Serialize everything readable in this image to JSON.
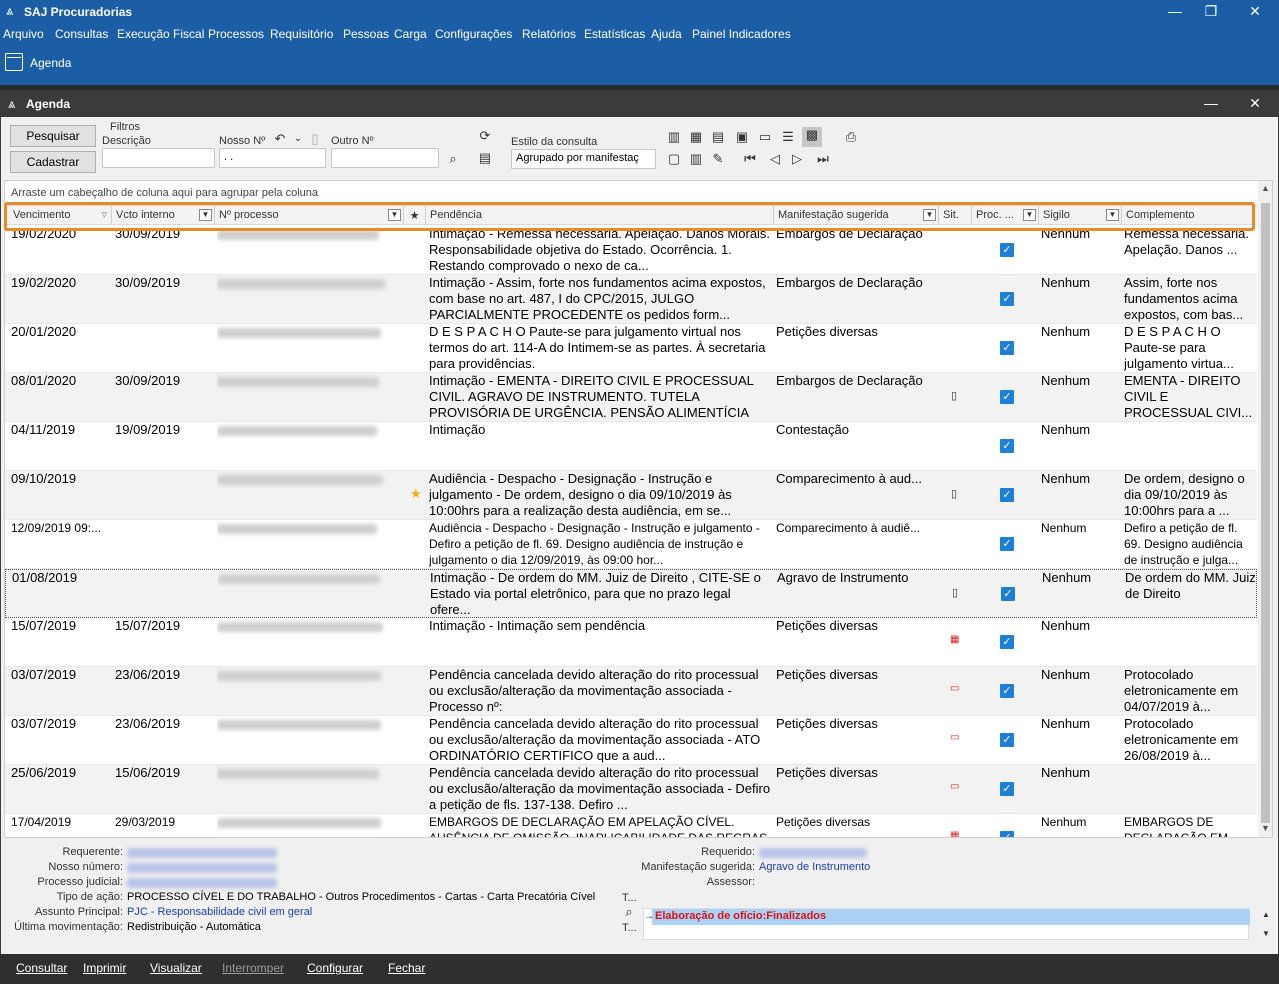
{
  "app": {
    "title": "SAJ Procuradorias"
  },
  "menu": [
    "Arquivo",
    "Consultas",
    "Execução Fiscal",
    "Processos",
    "Requisitório",
    "Pessoas",
    "Carga",
    "Configurações",
    "Relatórios",
    "Estatísticas",
    "Ajuda",
    "Painel Indicadores"
  ],
  "toolbar": {
    "agenda_label": "Agenda"
  },
  "window": {
    "title": "Agenda"
  },
  "filters": {
    "group_label": "Filtros",
    "pesquisar": "Pesquisar",
    "cadastrar": "Cadastrar",
    "descricao_label": "Descrição",
    "nosso_label": "Nosso Nº",
    "nosso_value": ". .",
    "outro_label": "Outro Nº",
    "estilo_label": "Estilo da consulta",
    "estilo_value": "Agrupado por manifestaç"
  },
  "grid": {
    "group_hint": "Arraste um cabeçalho de coluna aqui para agrupar pela coluna",
    "columns": [
      "Vencimento",
      "Vcto interno",
      "Nº processo",
      "★",
      "Pendência",
      "Manifestação sugerida",
      "Sit.",
      "Proc. ...",
      "Sigilo",
      "Complemento"
    ],
    "rows": [
      {
        "venc": "19/02/2020",
        "vcto": "30/09/2019",
        "pend": "Intimação - Remessa necessária. Apelação. Danos Morais. Responsabilidade objetiva do Estado. Ocorrência. 1. Restando comprovado o nexo de ca...",
        "manif": "Embargos de Declaração",
        "sit": "",
        "sigilo": "Nenhum",
        "comp": "Remessa necessária. Apelação. Danos ..."
      },
      {
        "venc": "19/02/2020",
        "vcto": "30/09/2019",
        "pend": "Intimação - Assim, forte nos fundamentos acima expostos, com base no art. 487, I do CPC/2015, JULGO PARCIALMENTE PROCEDENTE os pedidos form...",
        "manif": "Embargos de Declaração",
        "sit": "",
        "sigilo": "Nenhum",
        "comp": "Assim, forte nos fundamentos acima expostos, com bas..."
      },
      {
        "venc": "20/01/2020",
        "vcto": "",
        "pend": "D E S P A C H O Paute-se para julgamento virtual nos termos do art. 114-A do           Intimem-se as partes. À secretaria para providências.",
        "manif": "Petições diversas",
        "sit": "",
        "sigilo": "Nenhum",
        "comp": "D E S P A C H O Paute-se para julgamento virtua..."
      },
      {
        "venc": "08/01/2020",
        "vcto": "30/09/2019",
        "pend": "Intimação - EMENTA - DIREITO CIVIL E PROCESSUAL CIVIL. AGRAVO DE INSTRUMENTO. TUTELA PROVISÓRIA DE URGÊNCIA. PENSÃO ALIMENTÍCIA M...",
        "manif": "Embargos de Declaração",
        "sit": "doc",
        "sigilo": "Nenhum",
        "comp": "EMENTA - DIREITO CIVIL E PROCESSUAL CIVI..."
      },
      {
        "venc": "04/11/2019",
        "vcto": "19/09/2019",
        "pend": "Intimação",
        "manif": "Contestação",
        "sit": "",
        "sigilo": "Nenhum",
        "comp": ""
      },
      {
        "venc": "09/10/2019",
        "vcto": "",
        "pend": "Audiência - Despacho - Designação - Instrução e julgamento - De ordem, designo o dia 09/10/2019 às 10:00hrs para a realização desta audiência, em se...",
        "manif": "Comparecimento à aud...",
        "sit": "doc",
        "star": true,
        "sigilo": "Nenhum",
        "comp": "De ordem, designo o dia 09/10/2019 às 10:00hrs para a ..."
      },
      {
        "venc": "12/09/2019 09:...",
        "vcto": "",
        "pend": "Audiência - Despacho - Designação - Instrução e julgamento - Defiro a petição de fl. 69. Designo audiência de instrução e julgamento o dia 12/09/2019, às 09:00 hor...",
        "manif": "Comparecimento à audiê...",
        "sit": "",
        "sigilo": "Nenhum",
        "comp": "Defiro a petição de fl. 69. Designo audiência de instrução e julga...",
        "light": true
      },
      {
        "venc": "01/08/2019",
        "vcto": "",
        "pend": "Intimação - De ordem do MM. Juiz de Direito                                 , CITE-SE o Estado                       via portal eletrônico, para que no prazo legal ofere...",
        "manif": "Agravo de Instrumento",
        "sit": "doc",
        "sigilo": "Nenhum",
        "comp": "De ordem do MM. Juiz de Direito",
        "sel": true
      },
      {
        "venc": "15/07/2019",
        "vcto": "15/07/2019",
        "pend": "Intimação - Intimação sem pendência",
        "manif": "Petições diversas",
        "sit": "cal",
        "sigilo": "Nenhum",
        "comp": ""
      },
      {
        "venc": "03/07/2019",
        "vcto": "23/06/2019",
        "pend": "Pendência cancelada devido alteração do rito processual ou exclusão/alteração da movimentação associada - Processo nº:",
        "manif": "Petições diversas",
        "sit": "red",
        "sigilo": "Nenhum",
        "comp": "Protocolado eletronicamente em 04/07/2019 à..."
      },
      {
        "venc": "03/07/2019",
        "vcto": "23/06/2019",
        "pend": "Pendência cancelada devido alteração do rito processual ou exclusão/alteração da movimentação associada - ATO ORDINATÓRIO CERTIFICO que a aud...",
        "manif": "Petições diversas",
        "sit": "red",
        "sigilo": "Nenhum",
        "comp": "Protocolado eletronicamente em 26/08/2019 à..."
      },
      {
        "venc": "25/06/2019",
        "vcto": "15/06/2019",
        "pend": "Pendência cancelada devido alteração do rito processual ou exclusão/alteração da movimentação associada - Defiro a petição de fls. 137-138. Defiro ...",
        "manif": "Petições diversas",
        "sit": "red",
        "sigilo": "Nenhum",
        "comp": ""
      },
      {
        "venc": "17/04/2019",
        "vcto": "29/03/2019",
        "pend": "EMBARGOS DE DECLARAÇÃO EM APELAÇÃO CÍVEL. AUSÊNCIA DE OMISSÃO. INAPLICABILIDADE DAS REGRAS",
        "manif": "Petições diversas",
        "sit": "cal",
        "sigilo": "Nenhum",
        "comp": "EMBARGOS DE DECLARAÇÃO EM",
        "light": true
      }
    ]
  },
  "details": {
    "left": [
      {
        "label": "Requerente:",
        "value": "",
        "blur": true
      },
      {
        "label": "Nosso número:",
        "value": "",
        "blur": true
      },
      {
        "label": "Processo judicial:",
        "value": "",
        "blur": true
      },
      {
        "label": "Tipo de ação:",
        "value": "PROCESSO CÍVEL E DO TRABALHO - Outros Procedimentos - Cartas - Carta Precatória Cível"
      },
      {
        "label": "Assunto Principal:",
        "value": "PJC - Responsabilidade civil em geral",
        "link": true
      },
      {
        "label": "Última movimentação:",
        "value": "Redistribuição - Automática"
      }
    ],
    "right": [
      {
        "label": "Requerido:",
        "value": "",
        "blur": true
      },
      {
        "label": "Manifestação sugerida:",
        "value": "Agravo de Instrumento",
        "link": true
      },
      {
        "label": "Assessor:",
        "value": ""
      }
    ],
    "note": "Elaboração de ofício:Finalizados"
  },
  "bottom": {
    "buttons": [
      {
        "label": "Consultar",
        "enabled": true
      },
      {
        "label": "Imprimir",
        "enabled": true
      },
      {
        "label": "Visualizar",
        "enabled": true
      },
      {
        "label": "Interromper",
        "enabled": false
      },
      {
        "label": "Configurar",
        "enabled": true
      },
      {
        "label": "Fechar",
        "enabled": true
      }
    ]
  },
  "colors": {
    "brand": "#1b5ea6",
    "highlight": "#e8892a",
    "check": "#1e7fd6"
  }
}
